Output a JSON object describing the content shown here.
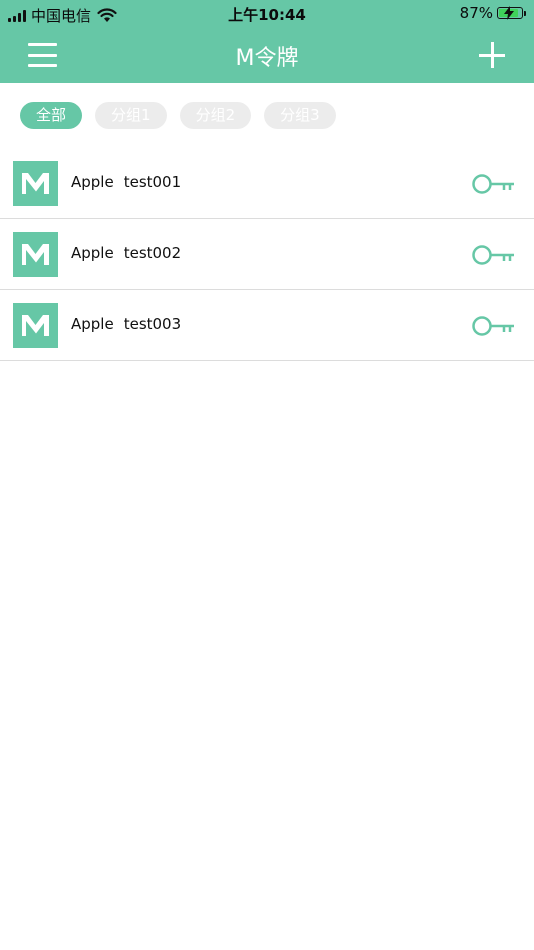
{
  "status_bar": {
    "carrier": "中国电信",
    "time": "上午10:44",
    "battery_percent": "87%",
    "battery_level": 0.87,
    "charging": true
  },
  "nav": {
    "title": "M令牌",
    "menu_icon": "hamburger-menu-icon",
    "add_icon": "plus-icon"
  },
  "filters": [
    {
      "label": "全部",
      "active": true
    },
    {
      "label": "分组1",
      "active": false
    },
    {
      "label": "分组2",
      "active": false
    },
    {
      "label": "分组3",
      "active": false
    }
  ],
  "accounts": [
    {
      "service": "Apple",
      "user": "test001",
      "icon": "m-logo-icon",
      "action_icon": "key-icon"
    },
    {
      "service": "Apple",
      "user": "test002",
      "icon": "m-logo-icon",
      "action_icon": "key-icon"
    },
    {
      "service": "Apple",
      "user": "test003",
      "icon": "m-logo-icon",
      "action_icon": "key-icon"
    }
  ],
  "colors": {
    "accent": "#66c7a6",
    "chip_inactive": "#ececec",
    "divider": "#dcdcdc"
  }
}
